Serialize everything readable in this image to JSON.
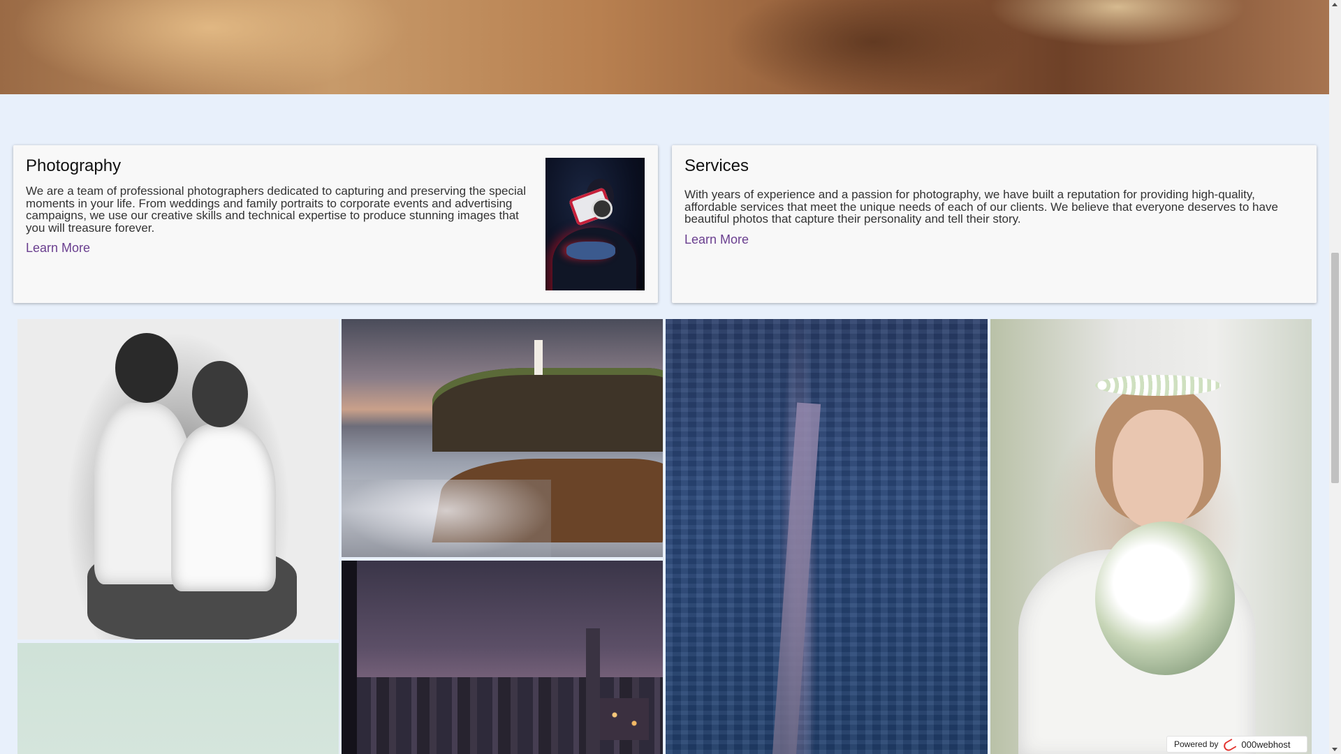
{
  "photography_card": {
    "title": "Photography",
    "text": "We are a team of professional photographers dedicated to capturing and preserving the special moments in your life. From weddings and family portraits to corporate events and advertising campaigns, we use our creative skills and technical expertise to produce stunning images that you will treasure forever.",
    "link_label": "Learn More"
  },
  "services_card": {
    "title": "Services",
    "text": "With years of experience and a passion for photography, we have built a reputation for providing high-quality, affordable services that meet the unique needs of each of our clients. We believe that everyone deserves to have beautiful photos that capture their personality and tell their story.",
    "link_label": "Learn More"
  },
  "footer_badge": {
    "label": "Powered by",
    "brand": "000webhost",
    "logo_icon": "000webhost-logo-icon"
  },
  "colors": {
    "background": "#e8f0fb",
    "card": "#f8f8f8",
    "link": "#6a3f8f"
  }
}
